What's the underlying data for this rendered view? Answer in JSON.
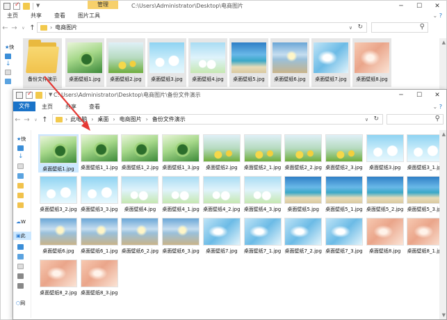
{
  "back": {
    "manage_label": "管理",
    "title_path": "C:\\Users\\Administrator\\Desktop\\电商图片",
    "ribbon": [
      "主页",
      "共享",
      "查看",
      "图片工具"
    ],
    "address_crumb": "电商图片",
    "sidebar_labels": [
      "快",
      "V",
      "网"
    ],
    "items": [
      {
        "name": "备份文件演示",
        "type": "folder"
      },
      {
        "name": "桌面壁纸1.jpg",
        "art": "a"
      },
      {
        "name": "桌面壁纸2.jpg",
        "art": "b"
      },
      {
        "name": "桌面壁纸3.jpg",
        "art": "c"
      },
      {
        "name": "桌面壁纸4.jpg",
        "art": "d"
      },
      {
        "name": "桌面壁纸5.jpg",
        "art": "e"
      },
      {
        "name": "桌面壁纸6.jpg",
        "art": "f"
      },
      {
        "name": "桌面壁纸7.jpg",
        "art": "g"
      },
      {
        "name": "桌面壁纸8.jpg",
        "art": "h"
      }
    ]
  },
  "front": {
    "title_path": "C:\\Users\\Administrator\\Desktop\\电商图片\\备份文件演示",
    "ribbon": [
      "文件",
      "主页",
      "共享",
      "查看"
    ],
    "address_crumbs": [
      "此电脑",
      "桌面",
      "电商图片",
      "备份文件演示"
    ],
    "sidebar_labels": [
      "快",
      "W",
      "此",
      "网"
    ],
    "files": [
      {
        "name": "桌面壁纸1.jpg",
        "art": "a"
      },
      {
        "name": "桌面壁纸1_1.jpg",
        "art": "a"
      },
      {
        "name": "桌面壁纸1_2.jpg",
        "art": "a"
      },
      {
        "name": "桌面壁纸1_3.jpg",
        "art": "a"
      },
      {
        "name": "桌面壁纸2.jpg",
        "art": "b"
      },
      {
        "name": "桌面壁纸2_1.jpg",
        "art": "b"
      },
      {
        "name": "桌面壁纸2_2.jpg",
        "art": "b"
      },
      {
        "name": "桌面壁纸2_3.jpg",
        "art": "b"
      },
      {
        "name": "桌面壁纸3.jpg",
        "art": "c"
      },
      {
        "name": "桌面壁纸3_1.jpg",
        "art": "c"
      },
      {
        "name": "桌面壁纸3_2.jpg",
        "art": "c"
      },
      {
        "name": "桌面壁纸3_3.jpg",
        "art": "c"
      },
      {
        "name": "桌面壁纸4.jpg",
        "art": "d"
      },
      {
        "name": "桌面壁纸4_1.jpg",
        "art": "d"
      },
      {
        "name": "桌面壁纸4_2.jpg",
        "art": "d"
      },
      {
        "name": "桌面壁纸4_3.jpg",
        "art": "d"
      },
      {
        "name": "桌面壁纸5.jpg",
        "art": "e"
      },
      {
        "name": "桌面壁纸5_1.jpg",
        "art": "e"
      },
      {
        "name": "桌面壁纸5_2.jpg",
        "art": "e"
      },
      {
        "name": "桌面壁纸5_3.jpg",
        "art": "e"
      },
      {
        "name": "桌面壁纸6.jpg",
        "art": "f"
      },
      {
        "name": "桌面壁纸6_1.jpg",
        "art": "f"
      },
      {
        "name": "桌面壁纸6_2.jpg",
        "art": "f"
      },
      {
        "name": "桌面壁纸6_3.jpg",
        "art": "f"
      },
      {
        "name": "桌面壁纸7.jpg",
        "art": "g"
      },
      {
        "name": "桌面壁纸7_1.jpg",
        "art": "g"
      },
      {
        "name": "桌面壁纸7_2.jpg",
        "art": "g"
      },
      {
        "name": "桌面壁纸7_3.jpg",
        "art": "g"
      },
      {
        "name": "桌面壁纸8.jpg",
        "art": "h"
      },
      {
        "name": "桌面壁纸8_1.jpg",
        "art": "h"
      },
      {
        "name": "桌面壁纸8_2.jpg",
        "art": "h"
      },
      {
        "name": "桌面壁纸8_3.jpg",
        "art": "h"
      }
    ]
  },
  "colors": {
    "accent": "#1a73c8",
    "manage_tab": "#f7d06b",
    "selection": "#cce8ff",
    "arrow": "#e53935",
    "folder": "#f1c24c"
  },
  "icons": {
    "back_nav": "arrow-left-icon",
    "forward_nav": "arrow-right-icon",
    "up_nav": "arrow-up-icon",
    "refresh": "refresh-icon",
    "search": "search-icon",
    "minimize": "minimize-icon",
    "maximize": "maximize-icon",
    "close": "close-icon"
  }
}
